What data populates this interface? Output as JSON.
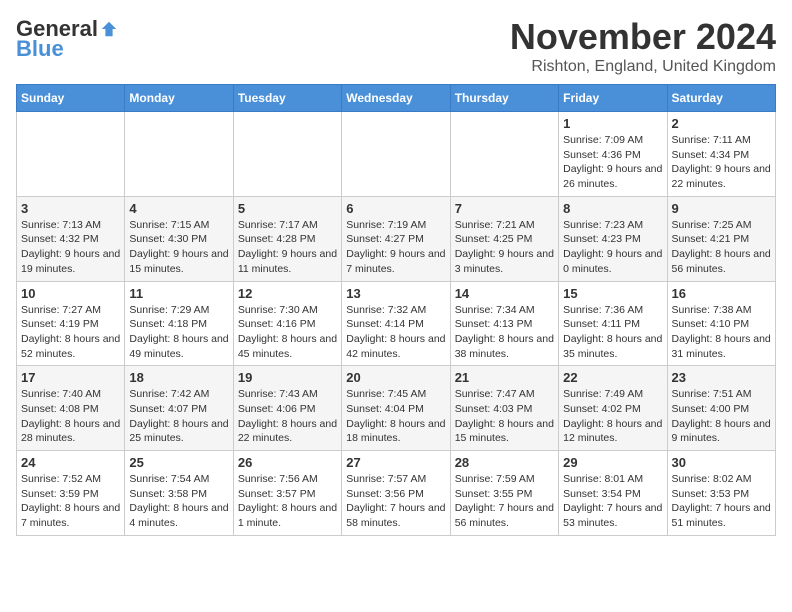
{
  "header": {
    "logo": {
      "general": "General",
      "blue": "Blue",
      "tagline": ""
    },
    "title": "November 2024",
    "location": "Rishton, England, United Kingdom"
  },
  "weekdays": [
    "Sunday",
    "Monday",
    "Tuesday",
    "Wednesday",
    "Thursday",
    "Friday",
    "Saturday"
  ],
  "weeks": [
    [
      {
        "day": "",
        "sunrise": "",
        "sunset": "",
        "daylight": ""
      },
      {
        "day": "",
        "sunrise": "",
        "sunset": "",
        "daylight": ""
      },
      {
        "day": "",
        "sunrise": "",
        "sunset": "",
        "daylight": ""
      },
      {
        "day": "",
        "sunrise": "",
        "sunset": "",
        "daylight": ""
      },
      {
        "day": "",
        "sunrise": "",
        "sunset": "",
        "daylight": ""
      },
      {
        "day": "1",
        "sunrise": "Sunrise: 7:09 AM",
        "sunset": "Sunset: 4:36 PM",
        "daylight": "Daylight: 9 hours and 26 minutes."
      },
      {
        "day": "2",
        "sunrise": "Sunrise: 7:11 AM",
        "sunset": "Sunset: 4:34 PM",
        "daylight": "Daylight: 9 hours and 22 minutes."
      }
    ],
    [
      {
        "day": "3",
        "sunrise": "Sunrise: 7:13 AM",
        "sunset": "Sunset: 4:32 PM",
        "daylight": "Daylight: 9 hours and 19 minutes."
      },
      {
        "day": "4",
        "sunrise": "Sunrise: 7:15 AM",
        "sunset": "Sunset: 4:30 PM",
        "daylight": "Daylight: 9 hours and 15 minutes."
      },
      {
        "day": "5",
        "sunrise": "Sunrise: 7:17 AM",
        "sunset": "Sunset: 4:28 PM",
        "daylight": "Daylight: 9 hours and 11 minutes."
      },
      {
        "day": "6",
        "sunrise": "Sunrise: 7:19 AM",
        "sunset": "Sunset: 4:27 PM",
        "daylight": "Daylight: 9 hours and 7 minutes."
      },
      {
        "day": "7",
        "sunrise": "Sunrise: 7:21 AM",
        "sunset": "Sunset: 4:25 PM",
        "daylight": "Daylight: 9 hours and 3 minutes."
      },
      {
        "day": "8",
        "sunrise": "Sunrise: 7:23 AM",
        "sunset": "Sunset: 4:23 PM",
        "daylight": "Daylight: 9 hours and 0 minutes."
      },
      {
        "day": "9",
        "sunrise": "Sunrise: 7:25 AM",
        "sunset": "Sunset: 4:21 PM",
        "daylight": "Daylight: 8 hours and 56 minutes."
      }
    ],
    [
      {
        "day": "10",
        "sunrise": "Sunrise: 7:27 AM",
        "sunset": "Sunset: 4:19 PM",
        "daylight": "Daylight: 8 hours and 52 minutes."
      },
      {
        "day": "11",
        "sunrise": "Sunrise: 7:29 AM",
        "sunset": "Sunset: 4:18 PM",
        "daylight": "Daylight: 8 hours and 49 minutes."
      },
      {
        "day": "12",
        "sunrise": "Sunrise: 7:30 AM",
        "sunset": "Sunset: 4:16 PM",
        "daylight": "Daylight: 8 hours and 45 minutes."
      },
      {
        "day": "13",
        "sunrise": "Sunrise: 7:32 AM",
        "sunset": "Sunset: 4:14 PM",
        "daylight": "Daylight: 8 hours and 42 minutes."
      },
      {
        "day": "14",
        "sunrise": "Sunrise: 7:34 AM",
        "sunset": "Sunset: 4:13 PM",
        "daylight": "Daylight: 8 hours and 38 minutes."
      },
      {
        "day": "15",
        "sunrise": "Sunrise: 7:36 AM",
        "sunset": "Sunset: 4:11 PM",
        "daylight": "Daylight: 8 hours and 35 minutes."
      },
      {
        "day": "16",
        "sunrise": "Sunrise: 7:38 AM",
        "sunset": "Sunset: 4:10 PM",
        "daylight": "Daylight: 8 hours and 31 minutes."
      }
    ],
    [
      {
        "day": "17",
        "sunrise": "Sunrise: 7:40 AM",
        "sunset": "Sunset: 4:08 PM",
        "daylight": "Daylight: 8 hours and 28 minutes."
      },
      {
        "day": "18",
        "sunrise": "Sunrise: 7:42 AM",
        "sunset": "Sunset: 4:07 PM",
        "daylight": "Daylight: 8 hours and 25 minutes."
      },
      {
        "day": "19",
        "sunrise": "Sunrise: 7:43 AM",
        "sunset": "Sunset: 4:06 PM",
        "daylight": "Daylight: 8 hours and 22 minutes."
      },
      {
        "day": "20",
        "sunrise": "Sunrise: 7:45 AM",
        "sunset": "Sunset: 4:04 PM",
        "daylight": "Daylight: 8 hours and 18 minutes."
      },
      {
        "day": "21",
        "sunrise": "Sunrise: 7:47 AM",
        "sunset": "Sunset: 4:03 PM",
        "daylight": "Daylight: 8 hours and 15 minutes."
      },
      {
        "day": "22",
        "sunrise": "Sunrise: 7:49 AM",
        "sunset": "Sunset: 4:02 PM",
        "daylight": "Daylight: 8 hours and 12 minutes."
      },
      {
        "day": "23",
        "sunrise": "Sunrise: 7:51 AM",
        "sunset": "Sunset: 4:00 PM",
        "daylight": "Daylight: 8 hours and 9 minutes."
      }
    ],
    [
      {
        "day": "24",
        "sunrise": "Sunrise: 7:52 AM",
        "sunset": "Sunset: 3:59 PM",
        "daylight": "Daylight: 8 hours and 7 minutes."
      },
      {
        "day": "25",
        "sunrise": "Sunrise: 7:54 AM",
        "sunset": "Sunset: 3:58 PM",
        "daylight": "Daylight: 8 hours and 4 minutes."
      },
      {
        "day": "26",
        "sunrise": "Sunrise: 7:56 AM",
        "sunset": "Sunset: 3:57 PM",
        "daylight": "Daylight: 8 hours and 1 minute."
      },
      {
        "day": "27",
        "sunrise": "Sunrise: 7:57 AM",
        "sunset": "Sunset: 3:56 PM",
        "daylight": "Daylight: 7 hours and 58 minutes."
      },
      {
        "day": "28",
        "sunrise": "Sunrise: 7:59 AM",
        "sunset": "Sunset: 3:55 PM",
        "daylight": "Daylight: 7 hours and 56 minutes."
      },
      {
        "day": "29",
        "sunrise": "Sunrise: 8:01 AM",
        "sunset": "Sunset: 3:54 PM",
        "daylight": "Daylight: 7 hours and 53 minutes."
      },
      {
        "day": "30",
        "sunrise": "Sunrise: 8:02 AM",
        "sunset": "Sunset: 3:53 PM",
        "daylight": "Daylight: 7 hours and 51 minutes."
      }
    ]
  ]
}
